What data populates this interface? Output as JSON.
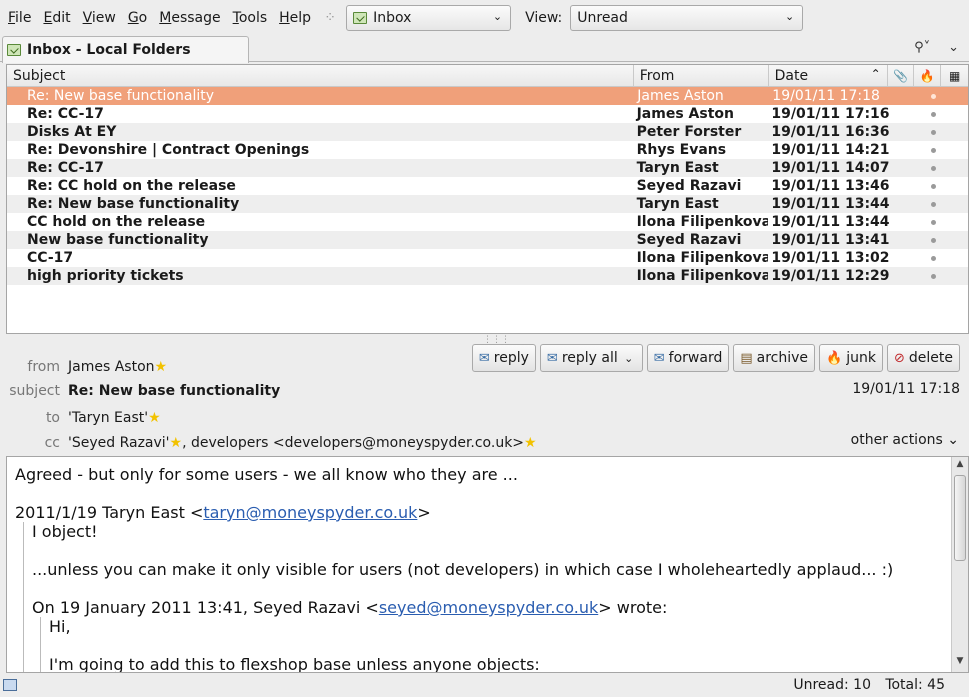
{
  "menu": {
    "items": [
      {
        "label": "File",
        "key": "F",
        "rest": "ile"
      },
      {
        "label": "Edit",
        "key": "E",
        "rest": "dit"
      },
      {
        "label": "View",
        "key": "V",
        "rest": "iew"
      },
      {
        "label": "Go",
        "key": "G",
        "rest": "o"
      },
      {
        "label": "Message",
        "key": "M",
        "rest": "essage"
      },
      {
        "label": "Tools",
        "key": "T",
        "rest": "ools"
      },
      {
        "label": "Help",
        "key": "H",
        "rest": "elp"
      }
    ]
  },
  "toolbar": {
    "folder_selector": "Inbox",
    "view_label": "View:",
    "view_selector": "Unread"
  },
  "tab": {
    "title": "Inbox - Local Folders"
  },
  "list": {
    "columns": {
      "subject": "Subject",
      "from": "From",
      "date": "Date"
    },
    "rows": [
      {
        "subject": "Re: New base functionality",
        "from": "James Aston",
        "date": "19/01/11 17:18",
        "selected": true
      },
      {
        "subject": "Re: CC-17",
        "from": "James Aston",
        "date": "19/01/11 17:16",
        "selected": false
      },
      {
        "subject": "Disks At EY",
        "from": "Peter Forster",
        "date": "19/01/11 16:36",
        "selected": false
      },
      {
        "subject": "Re: Devonshire | Contract Openings",
        "from": "Rhys Evans",
        "date": "19/01/11 14:21",
        "selected": false
      },
      {
        "subject": "Re: CC-17",
        "from": "Taryn East",
        "date": "19/01/11 14:07",
        "selected": false
      },
      {
        "subject": "Re: CC hold on the release",
        "from": "Seyed Razavi",
        "date": "19/01/11 13:46",
        "selected": false
      },
      {
        "subject": "Re: New base functionality",
        "from": "Taryn East",
        "date": "19/01/11 13:44",
        "selected": false
      },
      {
        "subject": "CC hold on the release",
        "from": "Ilona Filipenkova",
        "date": "19/01/11 13:44",
        "selected": false
      },
      {
        "subject": "New base functionality",
        "from": "Seyed Razavi",
        "date": "19/01/11 13:41",
        "selected": false
      },
      {
        "subject": "CC-17",
        "from": "Ilona Filipenkova",
        "date": "19/01/11 13:02",
        "selected": false
      },
      {
        "subject": "high priority tickets",
        "from": "Ilona Filipenkova",
        "date": "19/01/11 12:29",
        "selected": false
      }
    ]
  },
  "header": {
    "from_label": "from",
    "from_value": "James Aston",
    "subject_label": "subject",
    "subject_value": "Re: New base functionality",
    "date_value": "19/01/11 17:18",
    "to_label": "to",
    "to_value": "'Taryn East'",
    "cc_label": "cc",
    "cc_value_1": "'Seyed Razavi'",
    "cc_value_2": ", developers <developers@moneyspyder.co.uk>",
    "other_actions": "other actions",
    "buttons": {
      "reply": "reply",
      "reply_all": "reply all",
      "forward": "forward",
      "archive": "archive",
      "junk": "junk",
      "delete": "delete"
    }
  },
  "body": {
    "line1": "Agreed - but only for some users - we all know who they are ...",
    "attribution1_pre": "2011/1/19 Taryn East <",
    "attribution1_link": "taryn@moneyspyder.co.uk",
    "attribution1_post": ">",
    "q1_line1": "I object!",
    "q1_line2": "...unless you can make it only visible for users (not developers) in which case I wholeheartedly applaud... :)",
    "attribution2_pre": "On 19 January 2011 13:41, Seyed Razavi <",
    "attribution2_link": "seyed@moneyspyder.co.uk",
    "attribution2_post": "> wrote:",
    "q2_line1": "Hi,",
    "q2_line2": "I'm going to add this to flexshop base unless anyone objects:"
  },
  "status": {
    "unread": "Unread: 10",
    "total": "Total: 45"
  }
}
